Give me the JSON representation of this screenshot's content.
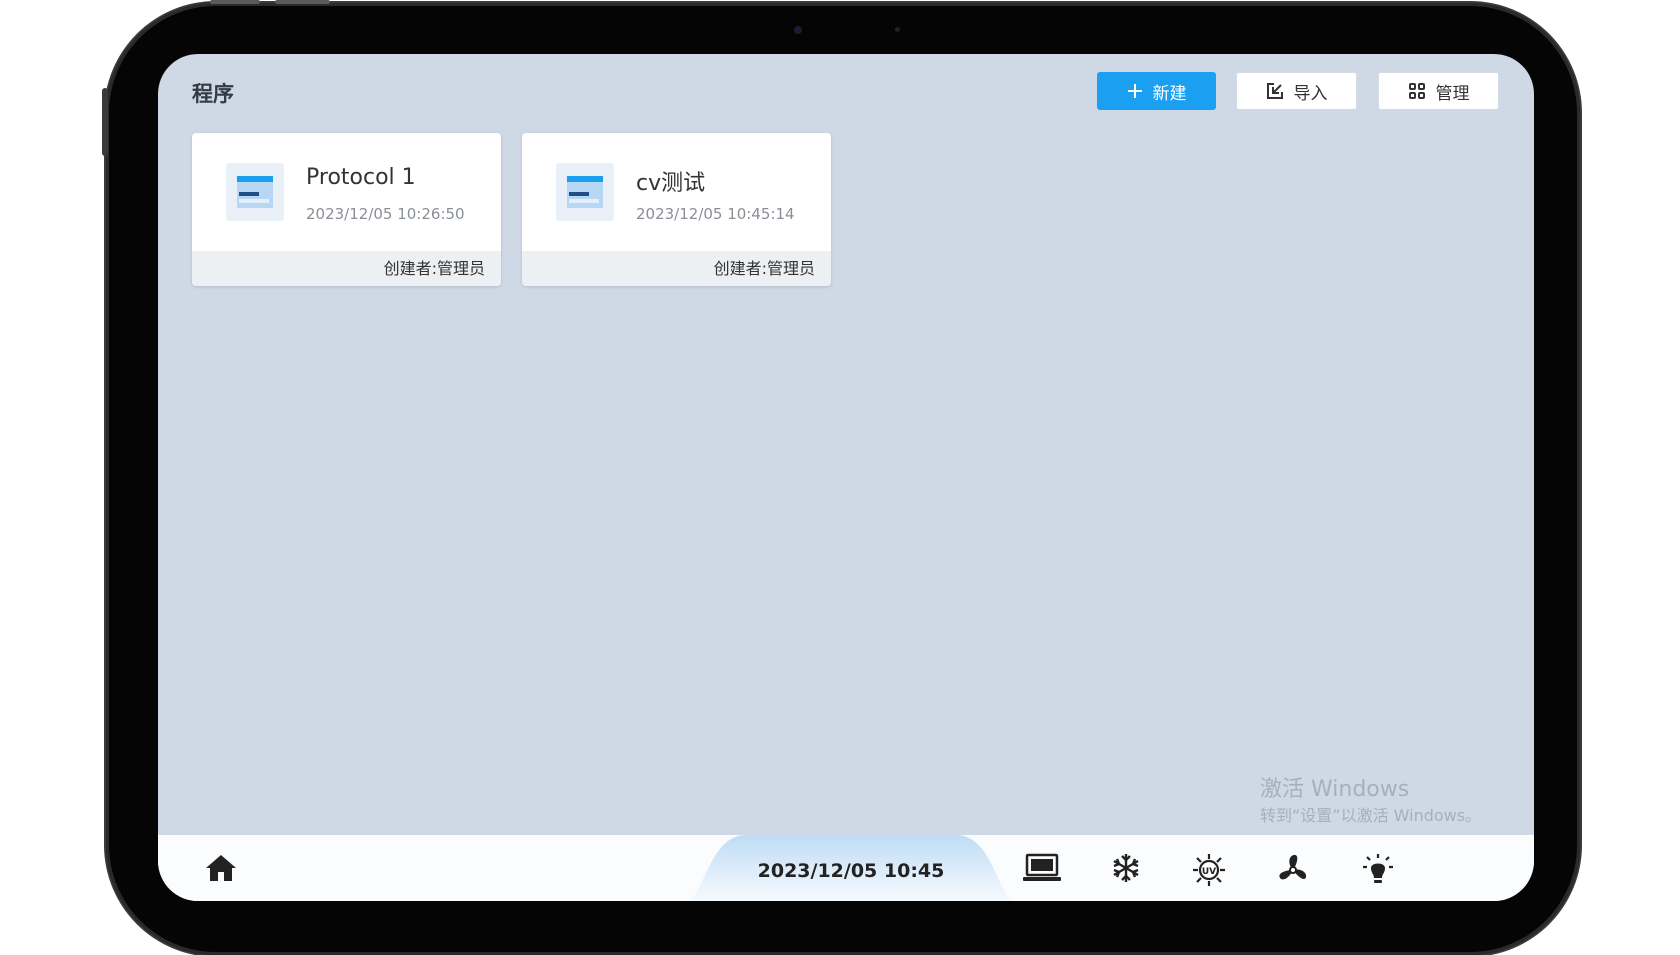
{
  "header": {
    "title": "程序",
    "new_label": "新建",
    "import_label": "导入",
    "manage_label": "管理"
  },
  "programs": [
    {
      "name": "Protocol 1",
      "date": "2023/12/05 10:26:50",
      "creator": "创建者:管理员"
    },
    {
      "name": "cv测试",
      "date": "2023/12/05 10:45:14",
      "creator": "创建者:管理员"
    }
  ],
  "watermark": {
    "line1": "激活 Windows",
    "line2": "转到“设置”以激活 Windows。"
  },
  "bottombar": {
    "datetime": "2023/12/05 10:45",
    "icons": [
      "home-icon",
      "tray-icon",
      "snowflake-icon",
      "uv-lamp-icon",
      "fan-icon",
      "light-bulb-icon"
    ]
  },
  "colors": {
    "accent": "#1b9ff0",
    "screen_background": "#ced9e5",
    "card_background": "#ffffff",
    "card_footer": "#edf0f3"
  }
}
